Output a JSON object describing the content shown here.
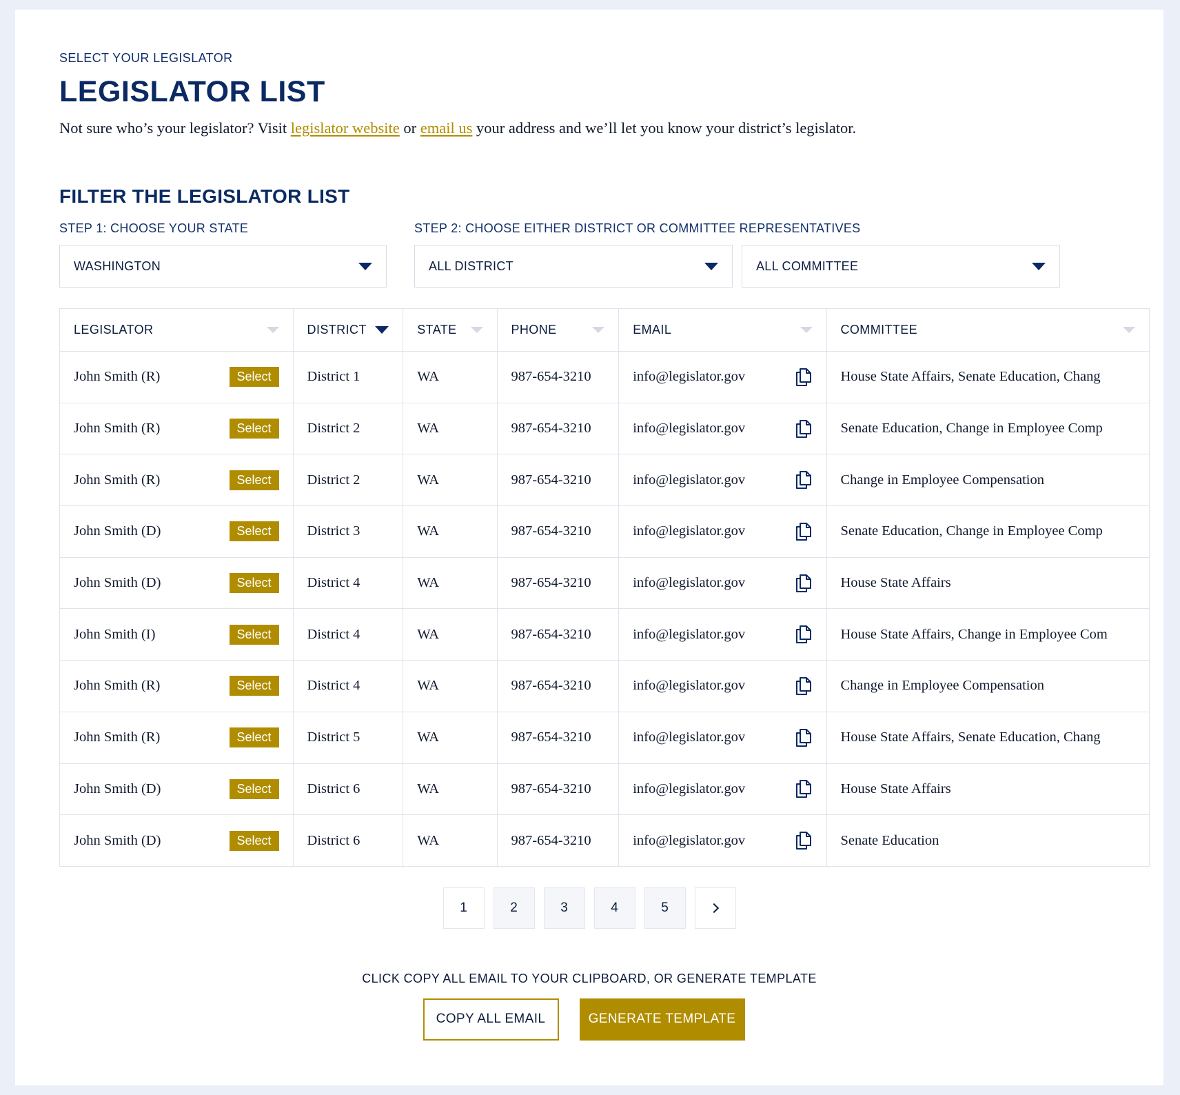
{
  "header": {
    "eyebrow": "SELECT YOUR LEGISLATOR",
    "title": "LEGISLATOR LIST",
    "intro_before": "Not sure who’s your legislator? Visit ",
    "intro_link1": "legislator website",
    "intro_middle": " or ",
    "intro_link2": "email us",
    "intro_after": " your address and we’ll let you know your district’s legislator."
  },
  "filters": {
    "title": "FILTER THE LEGISLATOR LIST",
    "step1_label": "STEP 1: CHOOSE YOUR STATE",
    "step2_label": "STEP 2: CHOOSE EITHER DISTRICT OR COMMITTEE REPRESENTATIVES",
    "state_value": "WASHINGTON",
    "district_value": "ALL DISTRICT",
    "committee_value": "ALL COMMITTEE"
  },
  "table": {
    "columns": [
      "LEGISLATOR",
      "DISTRICT",
      "STATE",
      "PHONE",
      "EMAIL",
      "COMMITTEE"
    ],
    "select_label": "Select",
    "rows": [
      {
        "legislator": "John Smith (R)",
        "district": "District 1",
        "state": "WA",
        "phone": "987-654-3210",
        "email": "info@legislator.gov",
        "committee": "House State Affairs, Senate Education, Chang"
      },
      {
        "legislator": "John Smith (R)",
        "district": "District 2",
        "state": "WA",
        "phone": "987-654-3210",
        "email": "info@legislator.gov",
        "committee": "Senate Education, Change in Employee Comp"
      },
      {
        "legislator": "John Smith (R)",
        "district": "District 2",
        "state": "WA",
        "phone": "987-654-3210",
        "email": "info@legislator.gov",
        "committee": "Change in Employee Compensation"
      },
      {
        "legislator": "John Smith (D)",
        "district": "District 3",
        "state": "WA",
        "phone": "987-654-3210",
        "email": "info@legislator.gov",
        "committee": "Senate Education, Change in Employee Comp"
      },
      {
        "legislator": "John Smith (D)",
        "district": "District 4",
        "state": "WA",
        "phone": "987-654-3210",
        "email": "info@legislator.gov",
        "committee": "House State Affairs"
      },
      {
        "legislator": "John Smith (I)",
        "district": "District 4",
        "state": "WA",
        "phone": "987-654-3210",
        "email": "info@legislator.gov",
        "committee": "House State Affairs, Change in Employee Com"
      },
      {
        "legislator": "John Smith (R)",
        "district": "District 4",
        "state": "WA",
        "phone": "987-654-3210",
        "email": "info@legislator.gov",
        "committee": "Change in Employee Compensation"
      },
      {
        "legislator": "John Smith (R)",
        "district": "District 5",
        "state": "WA",
        "phone": "987-654-3210",
        "email": "info@legislator.gov",
        "committee": "House State Affairs, Senate Education, Chang"
      },
      {
        "legislator": "John Smith (D)",
        "district": "District 6",
        "state": "WA",
        "phone": "987-654-3210",
        "email": "info@legislator.gov",
        "committee": "House State Affairs"
      },
      {
        "legislator": "John Smith (D)",
        "district": "District 6",
        "state": "WA",
        "phone": "987-654-3210",
        "email": "info@legislator.gov",
        "committee": "Senate Education"
      }
    ]
  },
  "pagination": {
    "pages": [
      "1",
      "2",
      "3",
      "4",
      "5"
    ],
    "current": "1",
    "next_icon": "chevron-right-icon"
  },
  "footer": {
    "note": "CLICK COPY ALL EMAIL TO YOUR CLIPBOARD, OR GENERATE TEMPLATE",
    "copy_all_label": "COPY ALL EMAIL",
    "generate_label": "GENERATE TEMPLATE"
  },
  "colors": {
    "navy": "#0b2a63",
    "gold": "#b08d00",
    "page_bg": "#ebeff7"
  }
}
